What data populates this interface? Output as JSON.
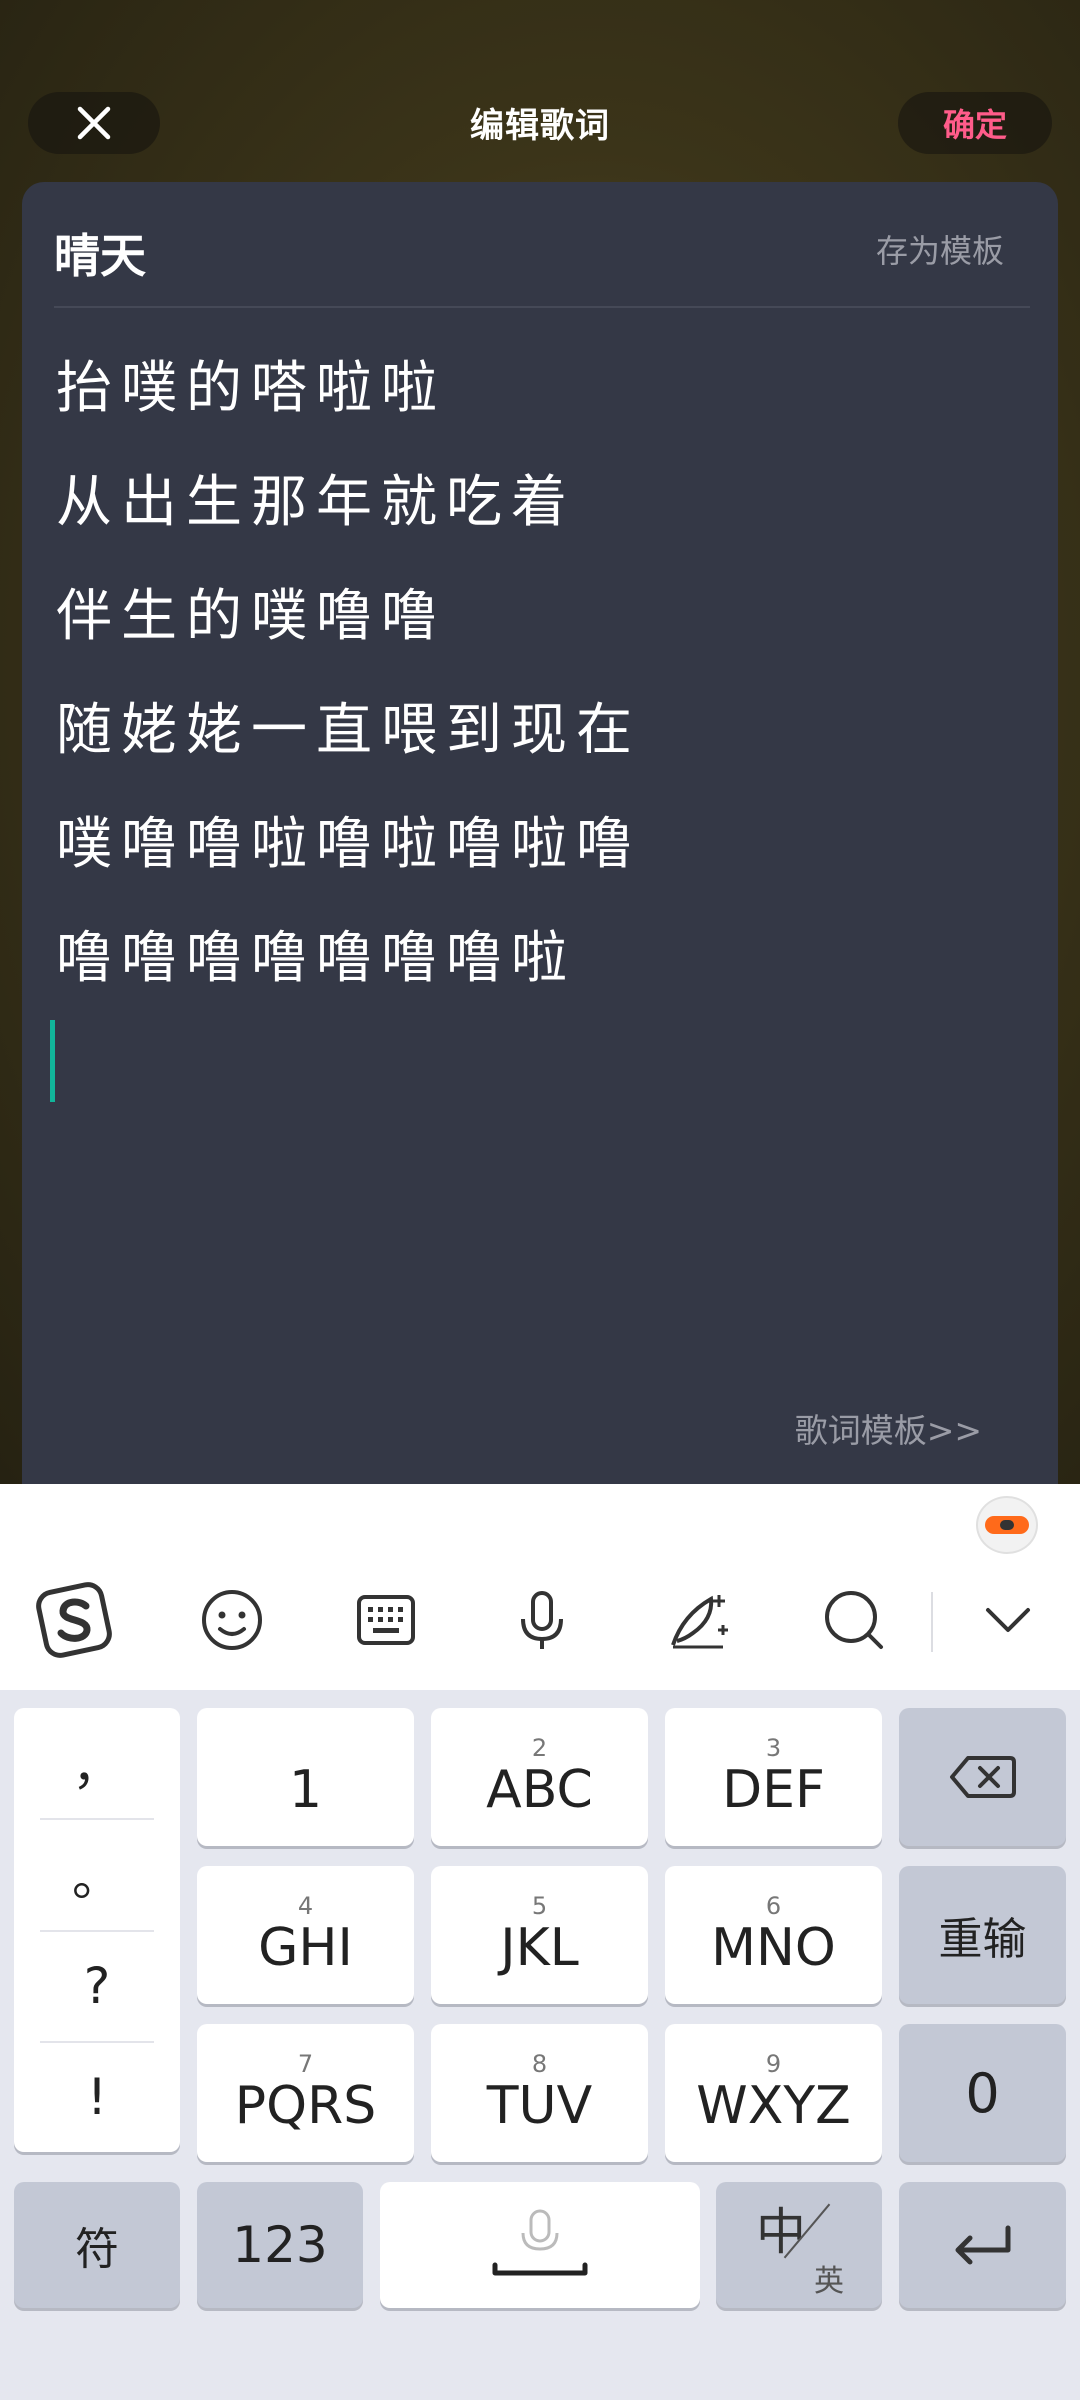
{
  "header": {
    "title": "编辑歌词",
    "confirm_label": "确定",
    "close_icon": "close-icon"
  },
  "editor": {
    "song_title": "晴天",
    "save_template_label": "存为模板",
    "lyrics": [
      "抬噗的嗒啦啦",
      "从出生那年就吃着",
      "伴生的噗噜噜",
      "随姥姥一直喂到现在",
      "噗噜噜啦噜啦噜啦噜",
      "噜噜噜噜噜噜噜啦"
    ],
    "template_link_label": "歌词模板>>"
  },
  "keyboard": {
    "toolbar_icons": [
      "sogou-logo-icon",
      "emoji-icon",
      "keyboard-icon",
      "microphone-icon",
      "handwriting-icon",
      "search-icon",
      "collapse-chevron-icon"
    ],
    "punctuation": [
      "，",
      "。",
      "?",
      "!"
    ],
    "keys": [
      {
        "num": "",
        "letters": "1"
      },
      {
        "num": "2",
        "letters": "ABC"
      },
      {
        "num": "3",
        "letters": "DEF"
      },
      {
        "num": "4",
        "letters": "GHI"
      },
      {
        "num": "5",
        "letters": "JKL"
      },
      {
        "num": "6",
        "letters": "MNO"
      },
      {
        "num": "7",
        "letters": "PQRS"
      },
      {
        "num": "8",
        "letters": "TUV"
      },
      {
        "num": "9",
        "letters": "WXYZ"
      }
    ],
    "retype_label": "重输",
    "zero_label": "0",
    "symbol_label": "符",
    "num_label": "123",
    "lang_zh": "中",
    "lang_en": "英"
  },
  "colors": {
    "accent_pink": "#ff5c8a",
    "cursor_teal": "#12b59a",
    "editor_bg": "#343846"
  }
}
